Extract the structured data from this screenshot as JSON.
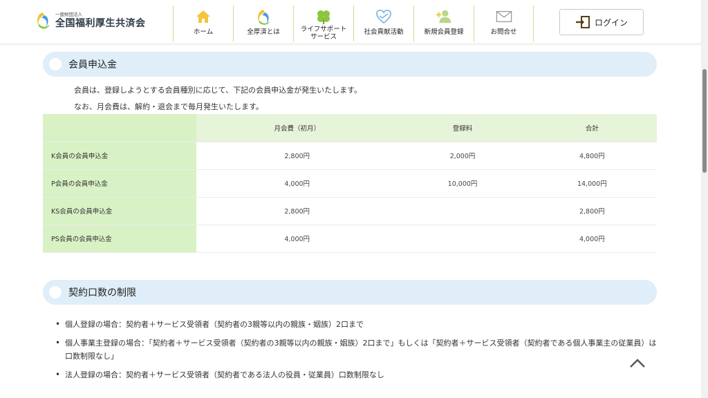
{
  "header": {
    "logo_sub": "一般財団法人",
    "logo_main": "全国福利厚生共済会",
    "login_label": "ログイン"
  },
  "nav": {
    "items": [
      {
        "label": "ホーム",
        "icon": "home-icon"
      },
      {
        "label": "全厚済とは",
        "icon": "logo-swirl-icon"
      },
      {
        "label_1": "ライフサポート",
        "label_2": "サービス",
        "icon": "clover-icon"
      },
      {
        "label": "社会貢献活動",
        "icon": "heart-hands-icon"
      },
      {
        "label": "新規会員登録",
        "icon": "add-user-icon"
      },
      {
        "label": "お問合せ",
        "icon": "mail-icon"
      }
    ]
  },
  "section1": {
    "title": "会員申込金",
    "line1": "会員は、登録しようとする会員種別に応じて、下記の会員申込金が発生いたします。",
    "line2": "なお、月会費は、解約・退会まで毎月発生いたします。"
  },
  "fee_table": {
    "headers": [
      "",
      "月会費（初月）",
      "登録料",
      "合計"
    ],
    "rows": [
      [
        "K会員の会員申込金",
        "2,800円",
        "2,000円",
        "4,800円"
      ],
      [
        "P会員の会員申込金",
        "4,000円",
        "10,000円",
        "14,000円"
      ],
      [
        "KS会員の会員申込金",
        "2,800円",
        "",
        "2,800円"
      ],
      [
        "PS会員の会員申込金",
        "4,000円",
        "",
        "4,000円"
      ]
    ]
  },
  "section2": {
    "title": "契約口数の制限",
    "bullets": [
      "個人登録の場合：契約者＋サービス受領者（契約者の3親等以内の親族・姻族）2口まで",
      "個人事業主登録の場合：「契約者＋サービス受領者（契約者の3親等以内の親族・姻族）2口まで」もしくは「契約者＋サービス受領者（契約者である個人事業主の従業員）は口数制限なし」",
      "法人登録の場合：契約者＋サービス受領者（契約者である法人の役員・従業員）口数制限なし"
    ]
  },
  "colors": {
    "nav_divider": "#c9dc9a",
    "section_bg": "#dfeef8",
    "table_label_bg": "#d8f2c6",
    "table_header_bg": "#e6f4d9"
  }
}
